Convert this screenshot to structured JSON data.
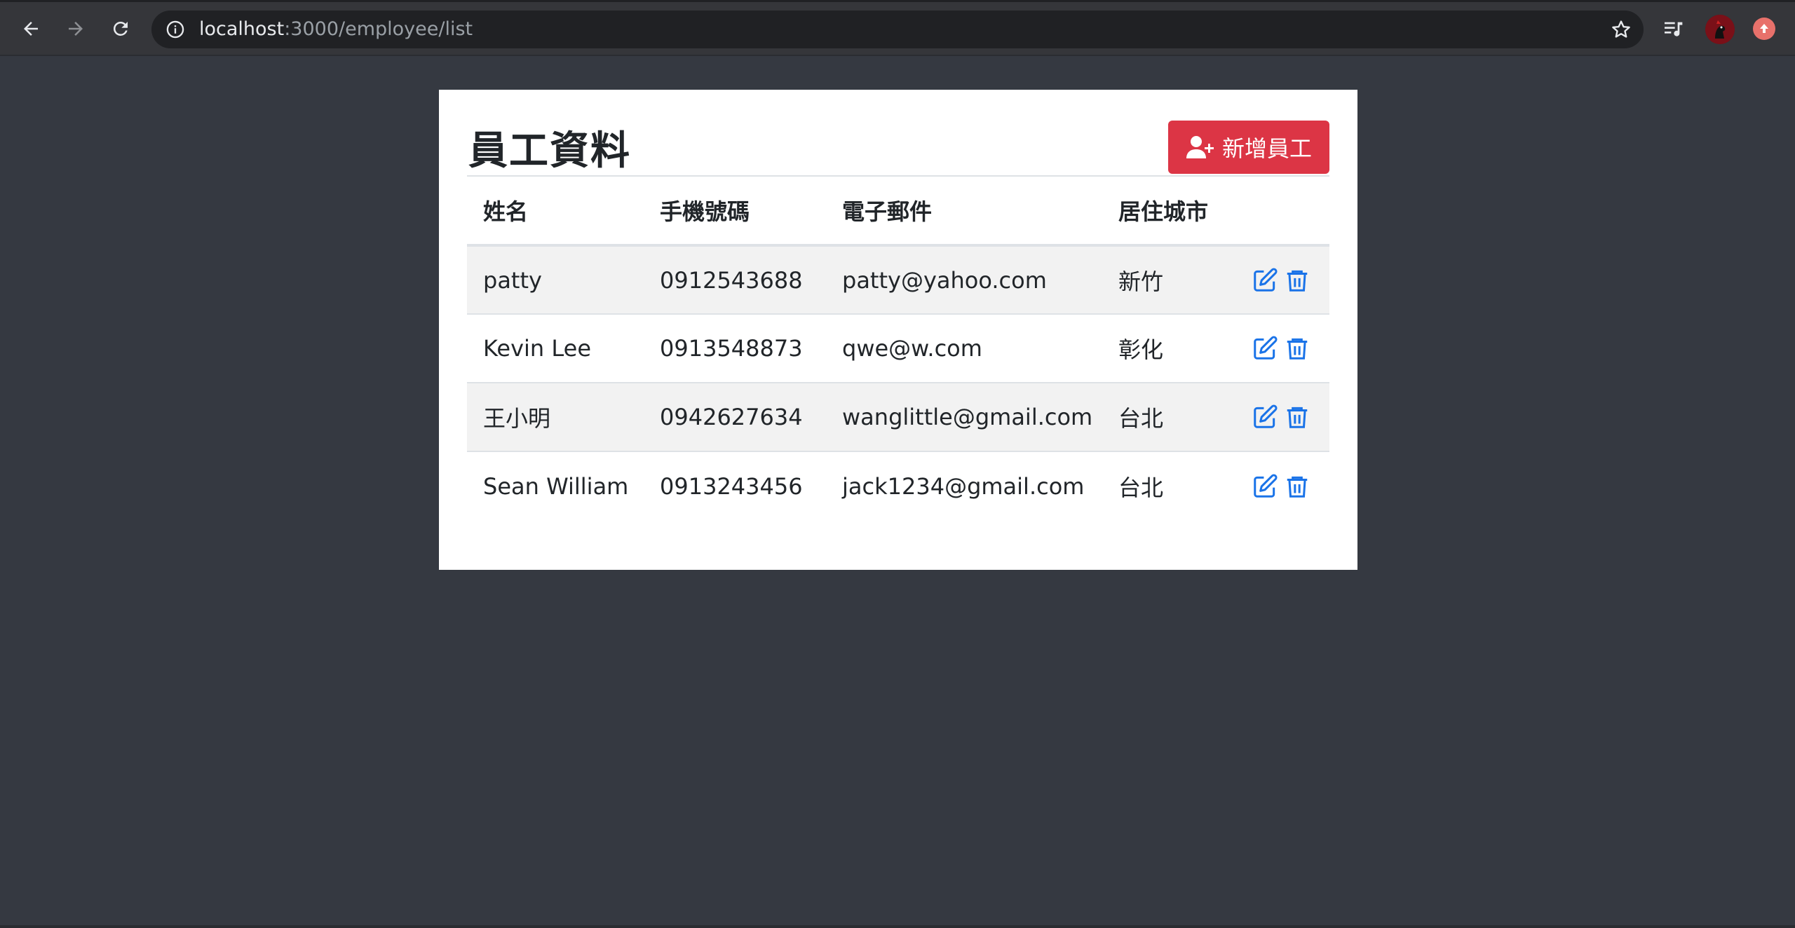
{
  "browser": {
    "url_host": "localhost",
    "url_path": ":3000/employee/list",
    "icons": [
      "back-icon",
      "forward-icon",
      "reload-icon",
      "info-icon",
      "star-icon",
      "media-queue-icon",
      "avatar",
      "extension-icon"
    ]
  },
  "page": {
    "title": "員工資料",
    "add_button_label": "新增員工",
    "accent_color": "#dc3545",
    "action_color": "#1a73e8"
  },
  "table": {
    "headers": [
      "姓名",
      "手機號碼",
      "電子郵件",
      "居住城市"
    ],
    "rows": [
      {
        "name": "patty",
        "phone": "0912543688",
        "email": "patty@yahoo.com",
        "city": "新竹"
      },
      {
        "name": "Kevin Lee",
        "phone": "0913548873",
        "email": "qwe@w.com",
        "city": "彰化"
      },
      {
        "name": "王小明",
        "phone": "0942627634",
        "email": "wanglittle@gmail.com",
        "city": "台北"
      },
      {
        "name": "Sean William",
        "phone": "0913243456",
        "email": "jack1234@gmail.com",
        "city": "台北"
      }
    ]
  }
}
